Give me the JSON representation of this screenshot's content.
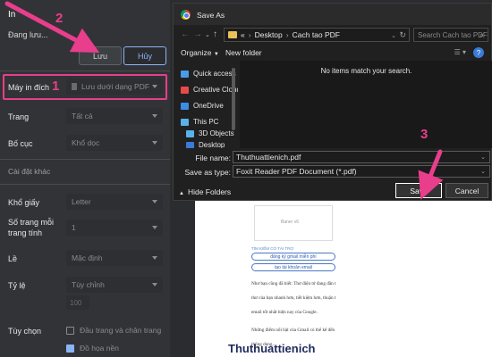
{
  "print_panel": {
    "title": "In",
    "status": "Đang lưu...",
    "save_button": "Lưu",
    "cancel_button": "Hủy",
    "destination_label": "Máy in đích",
    "destination_value": "Lưu dưới dạng PDF",
    "pages_label": "Trang",
    "pages_value": "Tất cả",
    "layout_label": "Bố cục",
    "layout_value": "Khổ dọc",
    "more_settings": "Cài đặt khác",
    "paper_size_label": "Khổ giấy",
    "paper_size_value": "Letter",
    "pages_per_sheet_label": "Số trang mỗi trang tính",
    "pages_per_sheet_value": "1",
    "margins_label": "Lề",
    "margins_value": "Mặc định",
    "scale_label": "Tỷ lệ",
    "scale_value": "Tùy chỉnh",
    "scale_input": "100",
    "options_label": "Tùy chọn",
    "option_headers": "Đầu trang và chân trang",
    "option_headers_checked": false,
    "option_background": "Đồ họa nền",
    "option_background_checked": true
  },
  "dialog": {
    "title": "Save As",
    "breadcrumb": [
      "«",
      "Desktop",
      "Cach tao PDF"
    ],
    "search_placeholder": "Search Cach tao PDF",
    "toolbar": {
      "organize": "Organize",
      "new_folder": "New folder",
      "help": "?"
    },
    "nav_items": [
      {
        "label": "Quick access",
        "icon": "star-icon",
        "color": "#4a9be8"
      },
      {
        "label": "Creative Cloud Fil",
        "icon": "creative-cloud-icon",
        "color": "#e84a4a"
      },
      {
        "label": "OneDrive",
        "icon": "cloud-icon",
        "color": "#3a8ee6"
      },
      {
        "label": "This PC",
        "icon": "pc-icon",
        "color": "#5ab0e8"
      },
      {
        "label": "3D Objects",
        "icon": "cube-icon",
        "color": "#5ab0e8"
      },
      {
        "label": "Desktop",
        "icon": "desktop-icon",
        "color": "#3a7bd5"
      }
    ],
    "empty_message": "No items match your search.",
    "file_name_label": "File name:",
    "file_name_value": "Thuthuattienich.pdf",
    "save_type_label": "Save as type:",
    "save_type_value": "Foxit Reader PDF Document (*.pdf)",
    "hide_folders": "Hide Folders",
    "save_button": "Save",
    "cancel_button": "Cancel"
  },
  "preview": {
    "ad_label": "Baner v6",
    "search_title": "TÌM KIẾM CÓ TÀI TRỢ",
    "pills": [
      "đăng ký gmail miễn phí",
      "tạo tài khoản email"
    ],
    "paragraph_lines": [
      "Như bạn cũng đã biết: Thư điện tử đang dần t",
      "thư của bạn nhanh hơn, tiết kiệm hơn, thuận t",
      "email tốt nhất hiện nay của Google.",
      "Những điểm nổi bật của Gmail có thể kể đến",
      "thông dụng..."
    ],
    "watermark": "Thuthuattienich"
  },
  "annotations": {
    "step1": "1",
    "step2": "2",
    "step3": "3"
  },
  "colors": {
    "accent": "#8ab4f8",
    "annotation": "#e83e8c"
  }
}
